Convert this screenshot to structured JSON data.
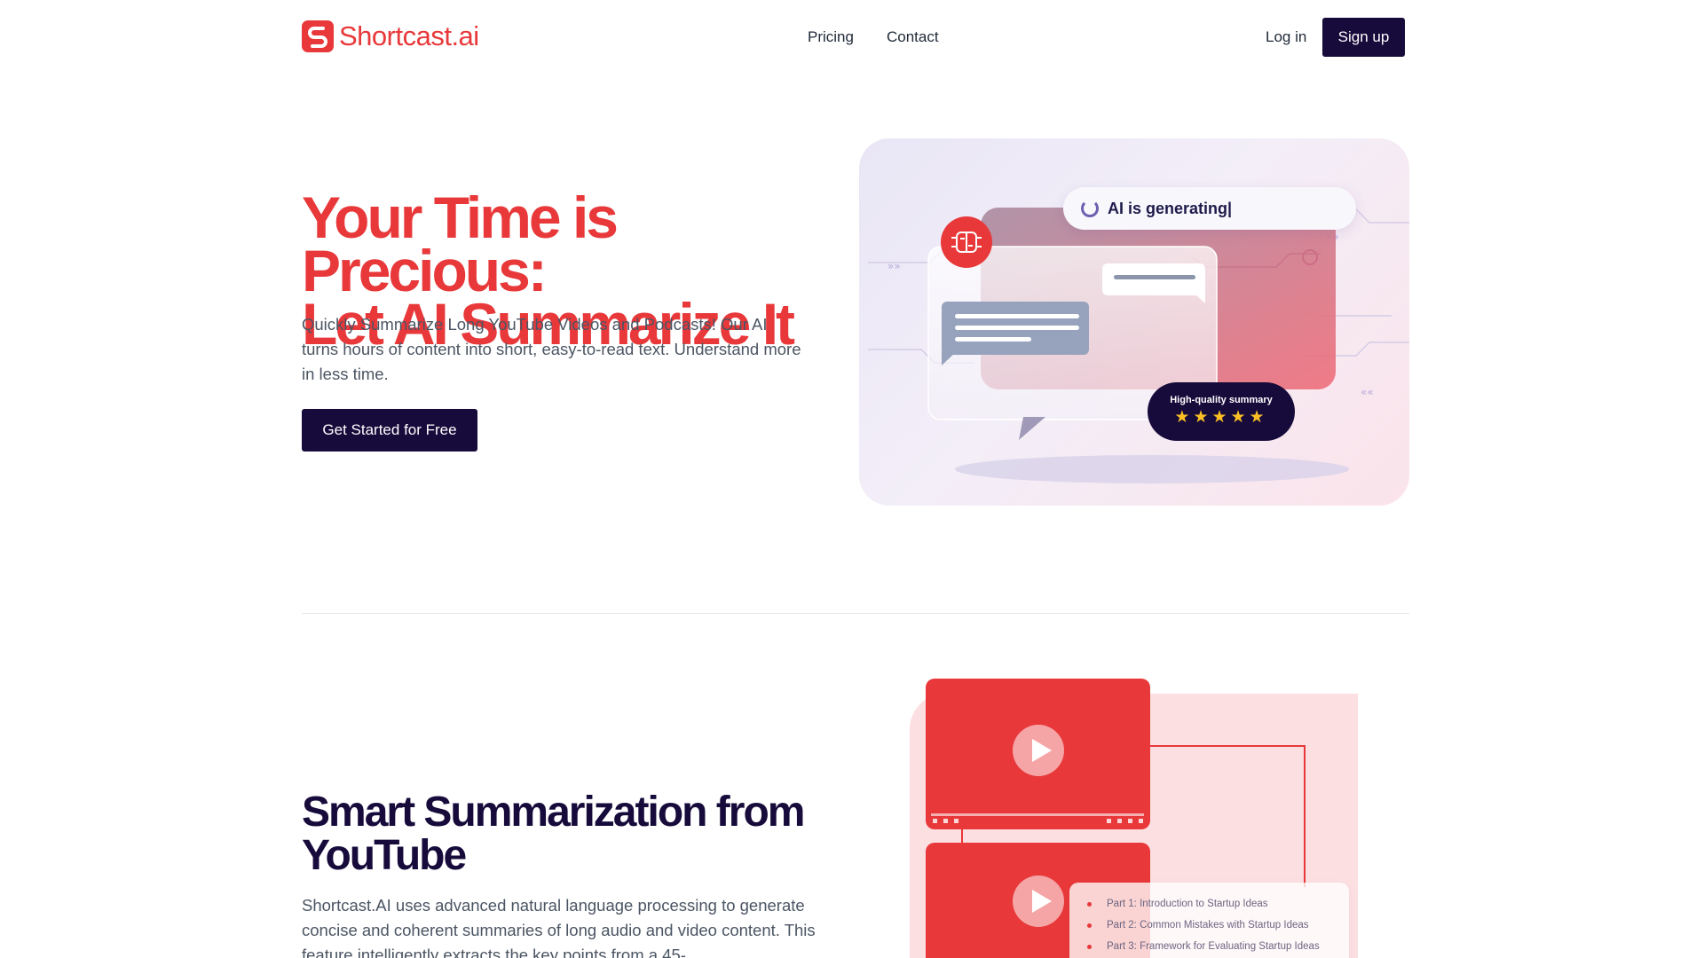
{
  "brand": {
    "name": "Shortcast.ai",
    "accent_color": "#e8383a",
    "dark_color": "#170b3b",
    "logo_icon": "shortcast-logo-icon"
  },
  "nav": {
    "links": [
      "Pricing",
      "Contact"
    ],
    "login_label": "Log in",
    "signup_label": "Sign up"
  },
  "hero": {
    "title_line1": "Your Time is Precious:",
    "title_line2": "Let AI Summarize It",
    "description": "Quickly Summarize Long YouTube Videos and Podcasts! Our AI turns hours of content into short, easy-to-read text. Understand more in less time.",
    "cta_label": "Get Started for Free",
    "illustration": {
      "generating_text": "AI is generating|",
      "summary_label": "High-quality summary",
      "stars": "★★★★★",
      "rating": 5
    }
  },
  "section2": {
    "title_line1": "Smart Summarization from",
    "title_line2": "YouTube",
    "description": "Shortcast.AI uses advanced natural language processing to generate concise and coherent summaries of long audio and video content. This feature intelligently extracts the key points from a 45-",
    "illustration": {
      "parts": [
        "Part 1: Introduction to Startup Ideas",
        "Part 2: Common Mistakes with Startup Ideas",
        "Part 3: Framework for Evaluating Startup Ideas"
      ]
    }
  }
}
